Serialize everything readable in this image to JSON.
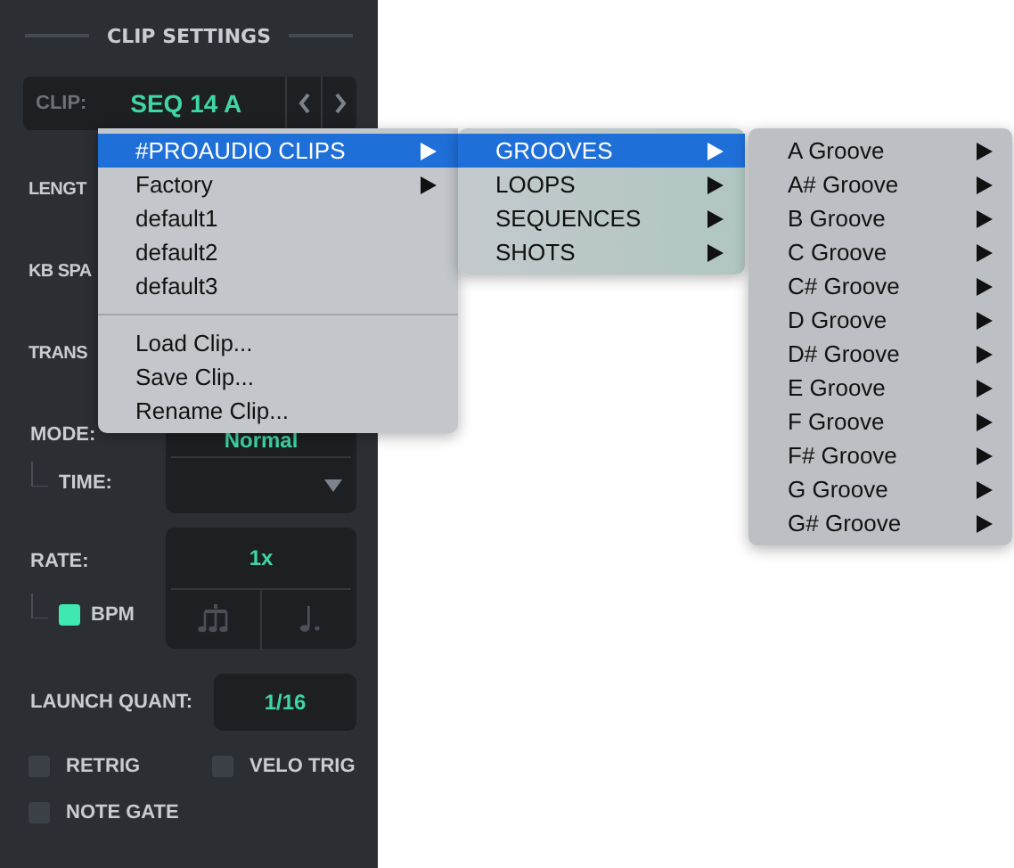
{
  "panel": {
    "title": "CLIP SETTINGS",
    "clip": {
      "label": "CLIP:",
      "value": "SEQ 14 A"
    },
    "covered_labels": [
      "LENGT",
      "KB SPA",
      "TRANS"
    ],
    "mode": {
      "label": "MODE:",
      "value": "Normal",
      "time_label": "TIME:"
    },
    "rate": {
      "label": "RATE:",
      "value": "1x",
      "bpm": {
        "label": "BPM",
        "checked": true
      }
    },
    "launch_quant": {
      "label": "LAUNCH QUANT:",
      "value": "1/16"
    },
    "toggles": [
      {
        "label": "RETRIG",
        "checked": false
      },
      {
        "label": "VELO TRIG",
        "checked": false
      },
      {
        "label": "NOTE GATE",
        "checked": false
      }
    ]
  },
  "menus": [
    {
      "items": [
        {
          "kind": "item",
          "label": "#PROAUDIO CLIPS",
          "selected": true,
          "submenu": true
        },
        {
          "kind": "item",
          "label": "Factory",
          "selected": false,
          "submenu": true
        },
        {
          "kind": "item",
          "label": "default1",
          "selected": false,
          "submenu": false
        },
        {
          "kind": "item",
          "label": "default2",
          "selected": false,
          "submenu": false
        },
        {
          "kind": "item",
          "label": "default3",
          "selected": false,
          "submenu": false
        },
        {
          "kind": "separator"
        },
        {
          "kind": "item",
          "label": "Load Clip...",
          "selected": false,
          "submenu": false
        },
        {
          "kind": "item",
          "label": "Save Clip...",
          "selected": false,
          "submenu": false
        },
        {
          "kind": "item",
          "label": "Rename Clip...",
          "selected": false,
          "submenu": false
        }
      ]
    },
    {
      "items": [
        {
          "kind": "item",
          "label": "GROOVES",
          "selected": true,
          "submenu": true
        },
        {
          "kind": "item",
          "label": "LOOPS",
          "selected": false,
          "submenu": true
        },
        {
          "kind": "item",
          "label": "SEQUENCES",
          "selected": false,
          "submenu": true
        },
        {
          "kind": "item",
          "label": "SHOTS",
          "selected": false,
          "submenu": true
        }
      ]
    },
    {
      "items": [
        {
          "kind": "item",
          "label": "A Groove",
          "selected": false,
          "submenu": true
        },
        {
          "kind": "item",
          "label": "A# Groove",
          "selected": false,
          "submenu": true
        },
        {
          "kind": "item",
          "label": "B Groove",
          "selected": false,
          "submenu": true
        },
        {
          "kind": "item",
          "label": "C Groove",
          "selected": false,
          "submenu": true
        },
        {
          "kind": "item",
          "label": "C# Groove",
          "selected": false,
          "submenu": true
        },
        {
          "kind": "item",
          "label": "D Groove",
          "selected": false,
          "submenu": true
        },
        {
          "kind": "item",
          "label": "D# Groove",
          "selected": false,
          "submenu": true
        },
        {
          "kind": "item",
          "label": "E Groove",
          "selected": false,
          "submenu": true
        },
        {
          "kind": "item",
          "label": "F Groove",
          "selected": false,
          "submenu": true
        },
        {
          "kind": "item",
          "label": "F# Groove",
          "selected": false,
          "submenu": true
        },
        {
          "kind": "item",
          "label": "G Groove",
          "selected": false,
          "submenu": true
        },
        {
          "kind": "item",
          "label": "G# Groove",
          "selected": false,
          "submenu": true
        }
      ]
    }
  ]
}
